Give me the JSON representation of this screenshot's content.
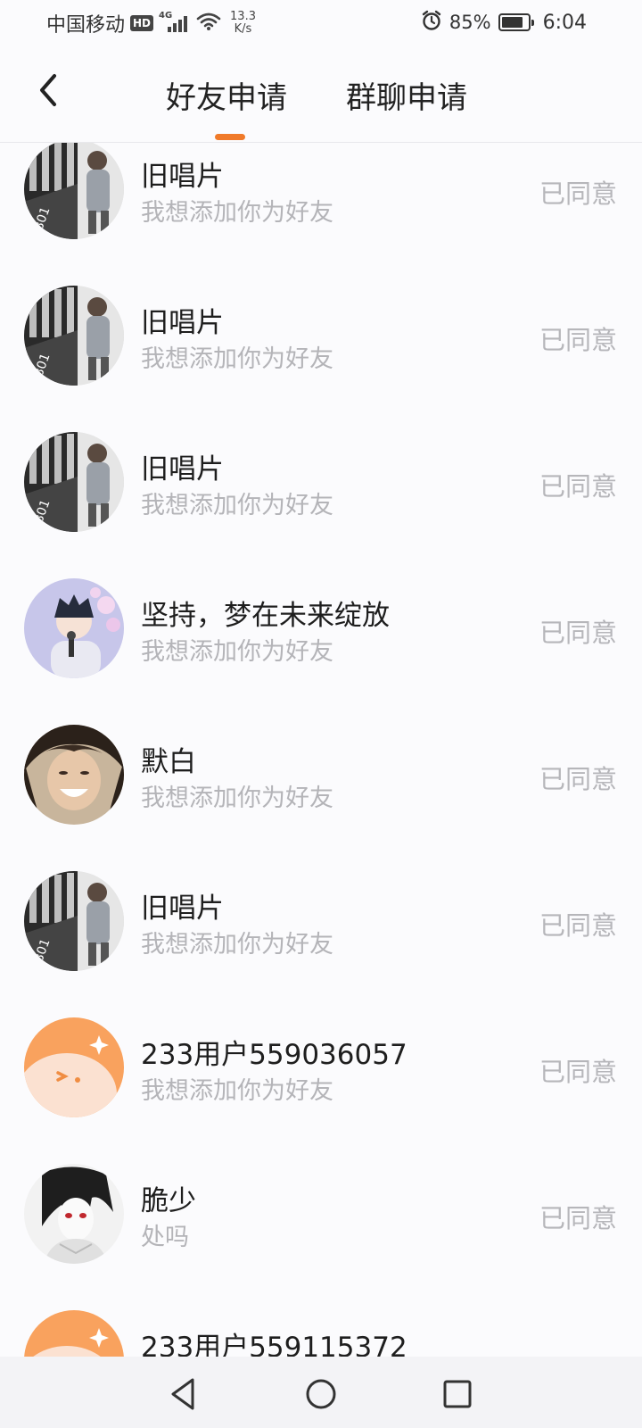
{
  "status_bar": {
    "carrier": "中国移动",
    "hd": "HD",
    "network": "4G",
    "speed_value": "13.3",
    "speed_unit": "K/s",
    "battery": "85%",
    "battery_level": 0.85,
    "time": "6:04",
    "icons": [
      "hd-badge-icon",
      "signal-icon",
      "wifi-icon",
      "alarm-icon",
      "battery-icon"
    ]
  },
  "header": {
    "back_icon": "chevron-left-icon",
    "tabs": [
      {
        "label": "好友申请",
        "active": true
      },
      {
        "label": "群聊申请",
        "active": false
      }
    ],
    "accent_color": "#f07a2a"
  },
  "requests": [
    {
      "name": "旧唱片",
      "message": "我想添加你为好友",
      "status": "已同意",
      "avatar": "photo-avatar-man-walking"
    },
    {
      "name": "旧唱片",
      "message": "我想添加你为好友",
      "status": "已同意",
      "avatar": "photo-avatar-man-walking"
    },
    {
      "name": "旧唱片",
      "message": "我想添加你为好友",
      "status": "已同意",
      "avatar": "photo-avatar-man-walking"
    },
    {
      "name": "坚持，梦在未来绽放",
      "message": "我想添加你为好友",
      "status": "已同意",
      "avatar": "anime-avatar-boy-blossoms"
    },
    {
      "name": "默白",
      "message": "我想添加你为好友",
      "status": "已同意",
      "avatar": "photo-avatar-smiling-person"
    },
    {
      "name": "旧唱片",
      "message": "我想添加你为好友",
      "status": "已同意",
      "avatar": "photo-avatar-man-walking"
    },
    {
      "name": "233用户559036057",
      "message": "我想添加你为好友",
      "status": "已同意",
      "avatar": "default-orange-avatar"
    },
    {
      "name": "脆少",
      "message": "处吗",
      "status": "已同意",
      "avatar": "anime-avatar-dark-hair"
    },
    {
      "name": "233用户559115372",
      "message": "",
      "status": "",
      "avatar": "default-orange-avatar"
    }
  ],
  "nav_bar": {
    "icons": [
      "back-triangle-icon",
      "home-circle-icon",
      "recent-square-icon"
    ]
  }
}
